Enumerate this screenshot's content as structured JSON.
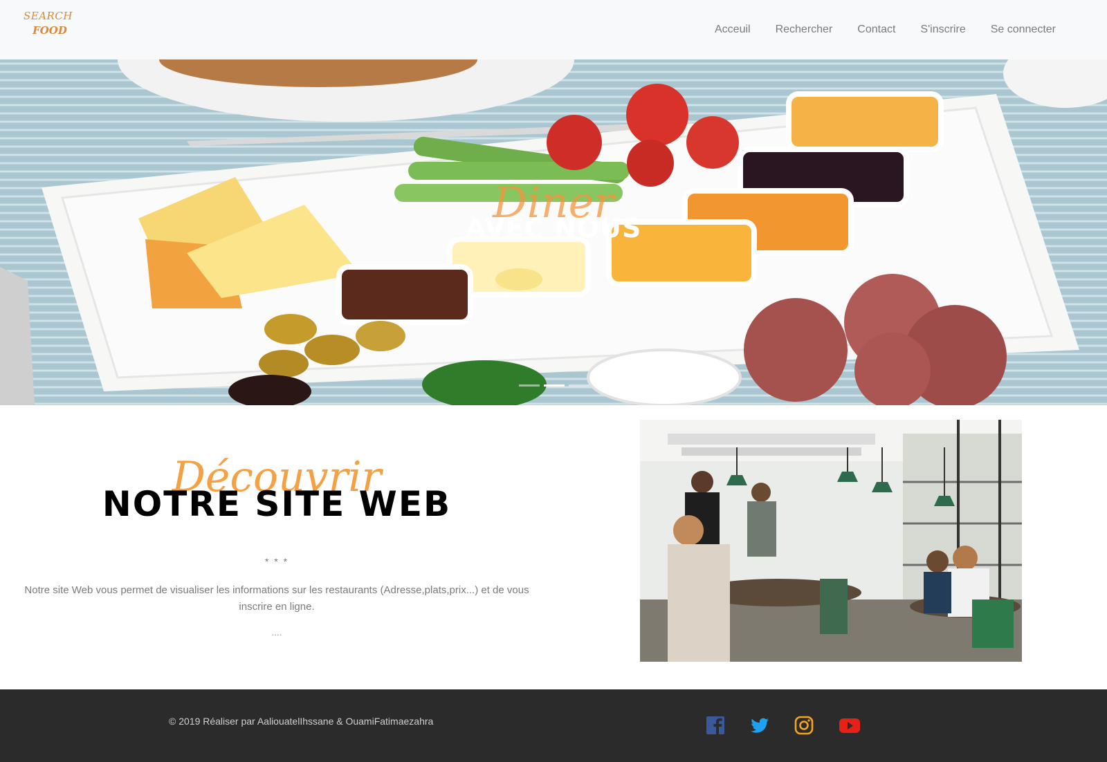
{
  "brand": {
    "line1": "SEARCH",
    "line2": "FOOD"
  },
  "nav": {
    "links": [
      "Acceuil",
      "Rechercher",
      "Contact",
      "S'inscrire",
      "Se connecter"
    ]
  },
  "hero": {
    "script_text": "Diner",
    "title": "AVEC NOUS",
    "slides": 3,
    "active_slide": 2
  },
  "about": {
    "script_text": "Découvrir",
    "title": "NOTRE SITE WEB",
    "stars": "* * *",
    "description": "Notre site Web vous permet de visualiser les informations sur les restaurants (Adresse,plats,prix...) et de vous inscrire en ligne.",
    "dots": "...."
  },
  "footer": {
    "copyright": "© 2019 Réaliser par AaliouatelIhssane & OuamiFatimaezahra",
    "social": [
      {
        "icon": "facebook-icon",
        "color": "#3b5998"
      },
      {
        "icon": "twitter-icon",
        "color": "#1da1f2"
      },
      {
        "icon": "instagram-icon",
        "color": "#f7a51c"
      },
      {
        "icon": "youtube-icon",
        "color": "#e62117"
      }
    ]
  },
  "colors": {
    "accent": "#f4a043",
    "navbar_bg": "#f8f9fa",
    "footer_bg": "#2b2b2b",
    "nav_text": "#7a7a7a"
  }
}
